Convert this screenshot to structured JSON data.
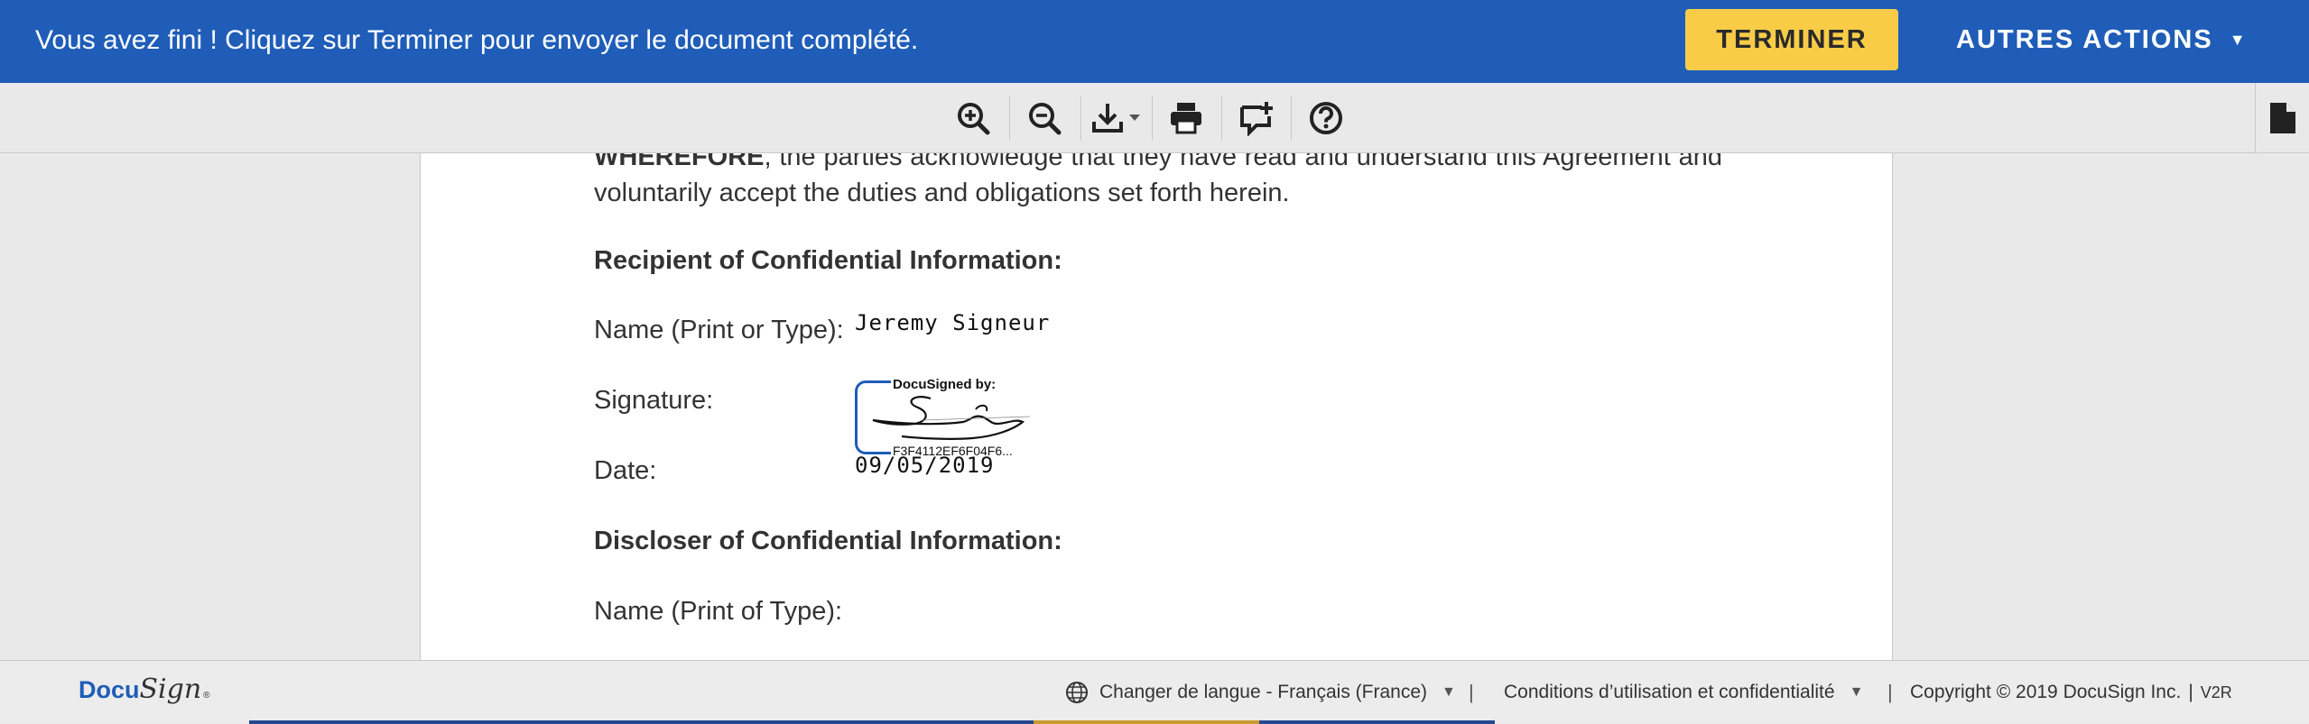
{
  "banner": {
    "message": "Vous avez fini ! Cliquez sur Terminer pour envoyer le document complété.",
    "finish_label": "TERMINER",
    "more_actions_label": "AUTRES ACTIONS"
  },
  "toolbar": {
    "tools": [
      "zoom-in-icon",
      "zoom-out-icon",
      "download-icon",
      "print-icon",
      "add-comment-icon",
      "help-icon"
    ],
    "side_tool": "document-icon"
  },
  "document": {
    "closing_bold": "WHEREFORE",
    "closing_text": ", the parties acknowledge that they have read and understand this Agreement and voluntarily accept the duties and obligations set forth herein.",
    "recipient_heading": "Recipient of Confidential Information:",
    "name_label": "Name (Print or Type):",
    "name_value": "Jeremy Signeur",
    "signature_label": "Signature:",
    "docusigned_by": "DocuSigned by:",
    "signature_id": "F3F4112EF6F04F6...",
    "date_label": "Date:",
    "date_value": "09/05/2019",
    "discloser_heading": "Discloser of Confidential Information:",
    "discloser_name_label": "Name (Print of Type):"
  },
  "footer": {
    "logo_docu": "Docu",
    "logo_sign": "Sign",
    "language_label": "Changer de langue - Français (France)",
    "separator": "|",
    "terms_label": "Conditions d’utilisation et confidentialité",
    "copyright": "Copyright © 2019 DocuSign Inc.",
    "version": "V2R"
  },
  "colors": {
    "banner_bg": "#1f5db8",
    "finish_button": "#f9cc48",
    "page_bg": "#ffffff",
    "chrome_bg": "#e9e9e9"
  }
}
